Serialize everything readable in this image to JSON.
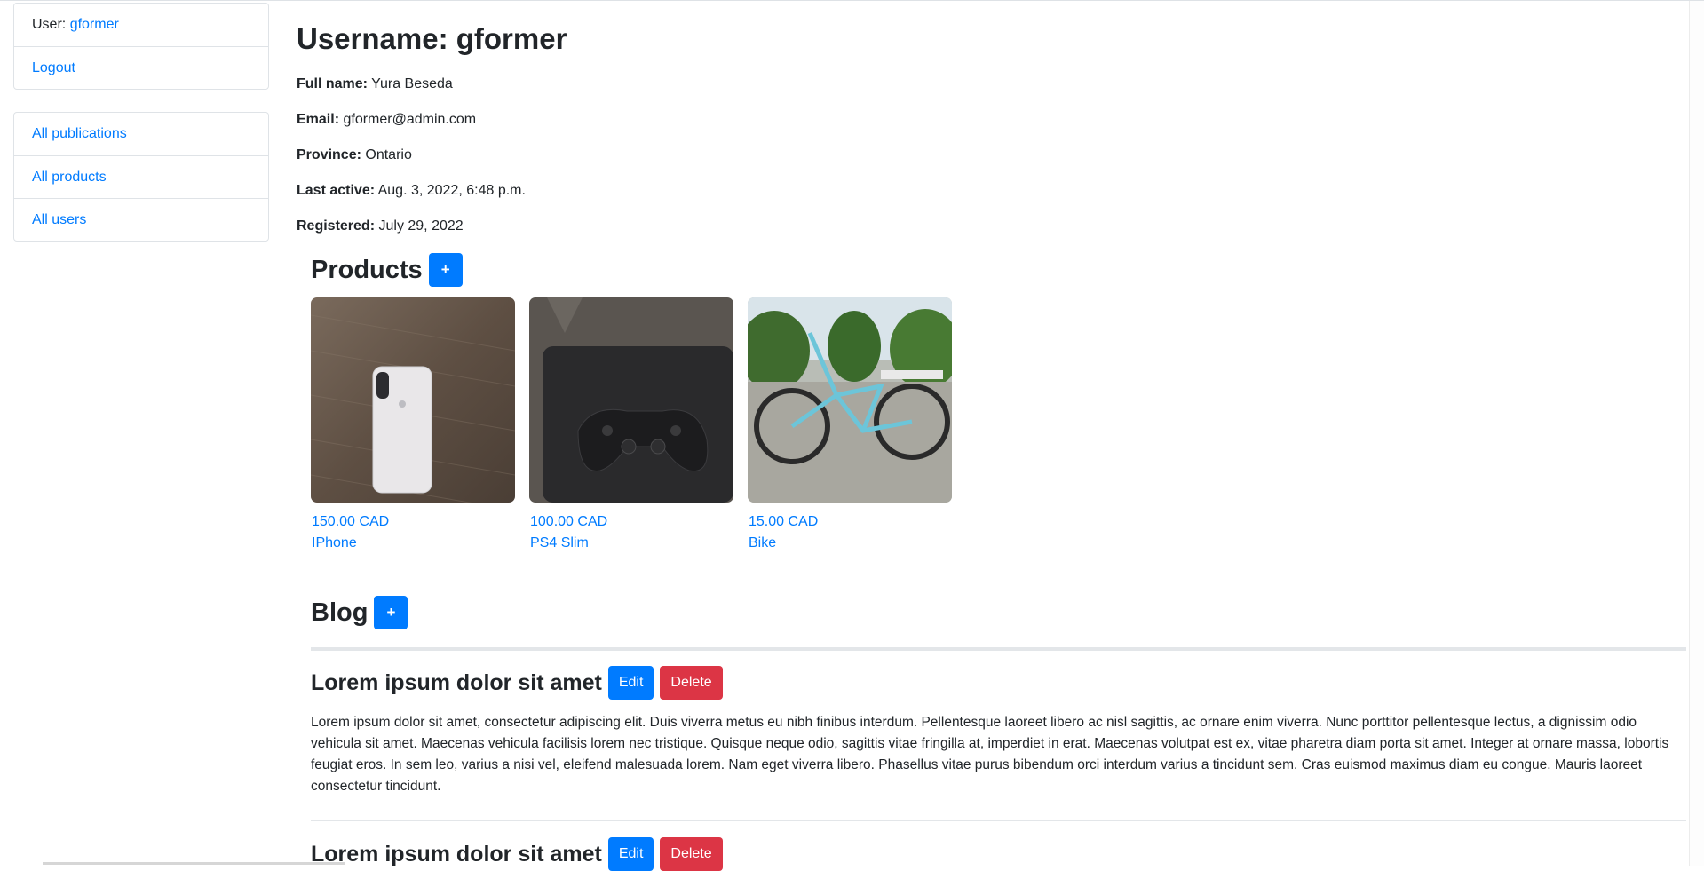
{
  "sidebar": {
    "user_label": "User:",
    "username": "gformer",
    "logout": "Logout",
    "nav": [
      {
        "label": "All publications"
      },
      {
        "label": "All products"
      },
      {
        "label": "All users"
      }
    ]
  },
  "profile": {
    "title": "Username: gformer",
    "fields": [
      {
        "label": "Full name:",
        "value": "Yura Beseda"
      },
      {
        "label": "Email:",
        "value": "gformer@admin.com"
      },
      {
        "label": "Province:",
        "value": "Ontario"
      },
      {
        "label": "Last active:",
        "value": "Aug. 3, 2022, 6:48 p.m."
      },
      {
        "label": "Registered:",
        "value": "July 29, 2022"
      }
    ]
  },
  "products": {
    "title": "Products",
    "add_label": "+",
    "items": [
      {
        "price": "150.00 CAD",
        "name": "IPhone",
        "image": "photo of white iphone on wooden table"
      },
      {
        "price": "100.00 CAD",
        "name": "PS4 Slim",
        "image": "photo of black ps4 controller on console"
      },
      {
        "price": "15.00 CAD",
        "name": "Bike",
        "image": "photo of light blue bicycle on gravel"
      }
    ]
  },
  "blog": {
    "title": "Blog",
    "add_label": "+",
    "edit_label": "Edit",
    "delete_label": "Delete",
    "posts": [
      {
        "title": "Lorem ipsum dolor sit amet",
        "body": "Lorem ipsum dolor sit amet, consectetur adipiscing elit. Duis viverra metus eu nibh finibus interdum. Pellentesque laoreet libero ac nisl sagittis, ac ornare enim viverra. Nunc porttitor pellentesque lectus, a dignissim odio vehicula sit amet. Maecenas vehicula facilisis lorem nec tristique. Quisque neque odio, sagittis vitae fringilla at, imperdiet in erat. Maecenas volutpat est ex, vitae pharetra diam porta sit amet. Integer at ornare massa, lobortis feugiat eros. In sem leo, varius a nisi vel, eleifend malesuada lorem. Nam eget viverra libero. Phasellus vitae purus bibendum orci interdum varius a tincidunt sem. Cras euismod maximus diam eu congue. Mauris laoreet consectetur tincidunt."
      },
      {
        "title": "Lorem ipsum dolor sit amet"
      }
    ]
  },
  "colors": {
    "primary": "#007bff",
    "danger": "#dc3545",
    "text": "#212529"
  }
}
